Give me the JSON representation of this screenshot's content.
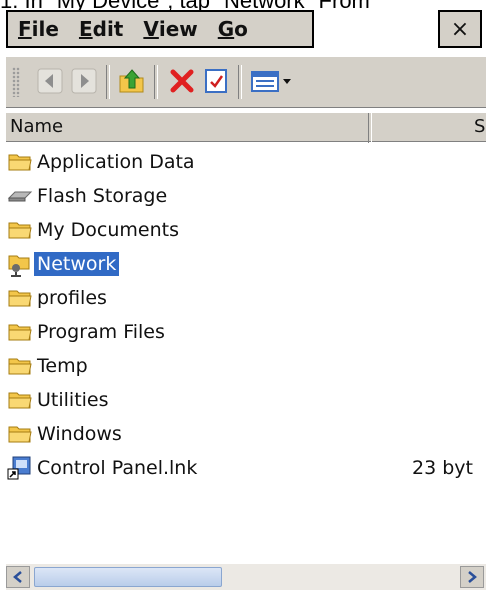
{
  "caption": "1. In \"My Device\", tap \"Network\" From",
  "menubar": {
    "items": [
      {
        "underline": "F",
        "rest": "ile"
      },
      {
        "underline": "E",
        "rest": "dit"
      },
      {
        "underline": "V",
        "rest": "iew"
      },
      {
        "underline": "G",
        "rest": "o"
      }
    ],
    "close_label": "×"
  },
  "toolbar": {
    "buttons": [
      "grip-icon",
      "back-arrow-icon",
      "forward-arrow-icon",
      "folder-up-icon",
      "delete-icon",
      "properties-icon",
      "view-menu-icon"
    ]
  },
  "columns": {
    "name": "Name",
    "size": "S"
  },
  "files": [
    {
      "name": "Application Data",
      "icon": "folder-icon",
      "size": ""
    },
    {
      "name": "Flash Storage",
      "icon": "drive-icon",
      "size": ""
    },
    {
      "name": "My Documents",
      "icon": "folder-icon",
      "size": ""
    },
    {
      "name": "Network",
      "icon": "network-folder-icon",
      "size": "",
      "selected": true
    },
    {
      "name": "profiles",
      "icon": "folder-icon",
      "size": ""
    },
    {
      "name": "Program Files",
      "icon": "folder-icon",
      "size": ""
    },
    {
      "name": "Temp",
      "icon": "folder-icon",
      "size": ""
    },
    {
      "name": "Utilities",
      "icon": "folder-icon",
      "size": ""
    },
    {
      "name": "Windows",
      "icon": "folder-icon",
      "size": ""
    },
    {
      "name": "Control Panel.lnk",
      "icon": "shortcut-icon",
      "size": "23 byt"
    }
  ],
  "colors": {
    "selection": "#316ac5",
    "chrome": "#d4d0c8",
    "folder": "#f3c64a"
  }
}
